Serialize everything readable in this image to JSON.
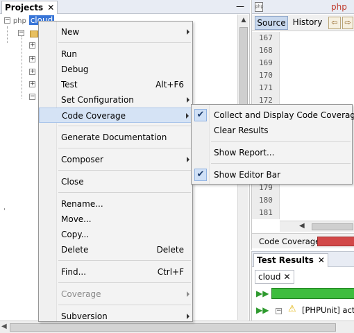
{
  "projects_panel": {
    "tab_label": "Projects",
    "close_glyph": "✕",
    "minimize_glyph": "—",
    "root_node": {
      "expander": "−",
      "icon_text": "php",
      "label": "cloud"
    }
  },
  "editor": {
    "file_tab_label": "php",
    "source_tab": "Source",
    "history_tab": "History",
    "line_numbers": [
      "167",
      "168",
      "169",
      "170",
      "171",
      "172",
      "179",
      "180",
      "181"
    ],
    "coverage_label": "Code Coverage:",
    "coverage_color": "#d24848"
  },
  "test_results": {
    "tab_label": "Test Results",
    "close_glyph": "✕",
    "session_tab": "cloud",
    "session_close": "✕",
    "progress_color": "#3ebd3e",
    "result_item": {
      "expander": "−",
      "label": "[PHPUnit] activi"
    }
  },
  "context_menu": {
    "items": {
      "new": "New",
      "run": "Run",
      "debug": "Debug",
      "test": "Test",
      "test_shortcut": "Alt+F6",
      "set_configuration": "Set Configuration",
      "code_coverage": "Code Coverage",
      "generate_documentation": "Generate Documentation",
      "composer": "Composer",
      "close": "Close",
      "rename": "Rename...",
      "move": "Move...",
      "copy": "Copy...",
      "delete": "Delete",
      "delete_shortcut": "Delete",
      "find": "Find...",
      "find_shortcut": "Ctrl+F",
      "coverage": "Coverage",
      "subversion": "Subversion"
    }
  },
  "coverage_submenu": {
    "collect": "Collect and Display Code Coverage",
    "collect_checked": true,
    "clear": "Clear Results",
    "show_report": "Show Report...",
    "show_editor_bar": "Show Editor Bar",
    "show_editor_bar_checked": true,
    "check_glyph": "✔"
  },
  "icons": {
    "tree_expander": "expander-icon",
    "folder": "folder-icon",
    "rerun": "rerun-icon",
    "warning": "warning-icon"
  }
}
